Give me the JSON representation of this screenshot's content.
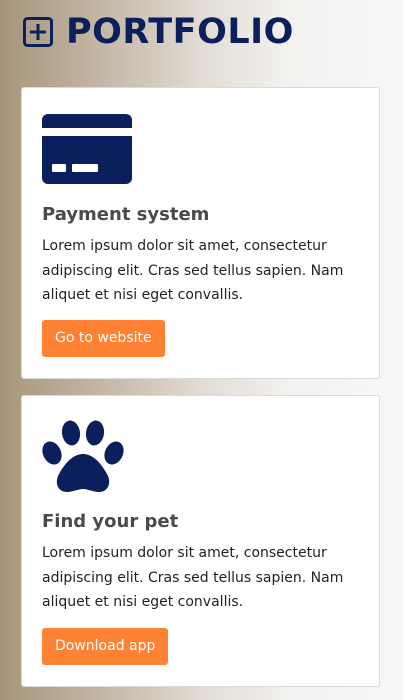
{
  "colors": {
    "primary": "#0b1f5c",
    "accent": "#ff8234",
    "card_bg": "#ffffff"
  },
  "header": {
    "icon": "plus-square-icon",
    "title": "PORTFOLIO"
  },
  "cards": [
    {
      "icon": "credit-card-icon",
      "title": "Payment system",
      "text": "Lorem ipsum dolor sit amet, consectetur adipiscing elit. Cras sed tellus sapien. Nam aliquet et nisi eget convallis.",
      "button_label": "Go to website"
    },
    {
      "icon": "paw-icon",
      "title": "Find your pet",
      "text": "Lorem ipsum dolor sit amet, consectetur adipiscing elit. Cras sed tellus sapien. Nam aliquet et nisi eget convallis.",
      "button_label": "Download app"
    }
  ]
}
